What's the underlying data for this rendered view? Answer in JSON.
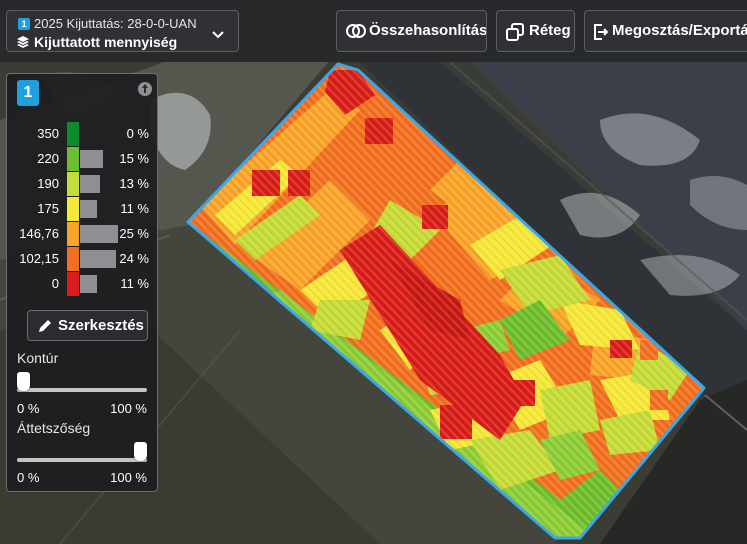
{
  "topbar": {
    "layer_select": {
      "badge": "1",
      "subtitle": "2025 Kijuttatás: 28-0-0-UAN",
      "title": "Kijuttatott mennyiség"
    },
    "compare_label": "Összehasonlítás",
    "layer_label": "Réteg",
    "share_label": "Megosztás/Exportálás"
  },
  "legend": {
    "badge": "1",
    "rows": [
      {
        "value": "350",
        "percent": "0 %",
        "share": 0,
        "color": "#0e8a2e"
      },
      {
        "value": "220",
        "percent": "15 %",
        "share": 15,
        "color": "#6cbf31"
      },
      {
        "value": "190",
        "percent": "13 %",
        "share": 13,
        "color": "#c4dd3a"
      },
      {
        "value": "175",
        "percent": "11 %",
        "share": 11,
        "color": "#f5e93a"
      },
      {
        "value": "146,76",
        "percent": "25 %",
        "share": 25,
        "color": "#f9a52c"
      },
      {
        "value": "102,15",
        "percent": "24 %",
        "share": 24,
        "color": "#f26f22"
      },
      {
        "value": "0",
        "percent": "11 %",
        "share": 11,
        "color": "#d91c1c"
      }
    ],
    "edit_label": "Szerkesztés",
    "contour": {
      "label": "Kontúr",
      "min_label": "0 %",
      "max_label": "100 %",
      "value": 0
    },
    "opacity": {
      "label": "Áttetszőség",
      "min_label": "0 %",
      "max_label": "100 %",
      "value": 100
    }
  },
  "colors": {
    "accent": "#1ea0e0",
    "field_outline": "#3aa8e8"
  }
}
